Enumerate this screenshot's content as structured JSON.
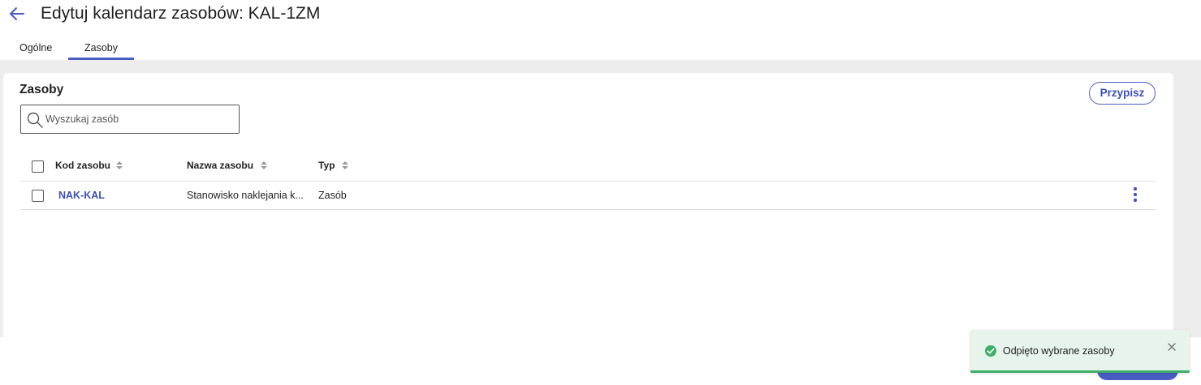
{
  "header": {
    "title": "Edytuj kalendarz zasobów: KAL-1ZM",
    "back_icon": "arrow-left-icon"
  },
  "tabs": [
    {
      "label": "Ogólne",
      "active": false
    },
    {
      "label": "Zasoby",
      "active": true
    }
  ],
  "panel": {
    "title": "Zasoby",
    "assign_label": "Przypisz",
    "search": {
      "placeholder": "Wyszukaj zasób",
      "value": ""
    }
  },
  "table": {
    "columns": [
      "Kod zasobu",
      "Nazwa zasobu",
      "Typ"
    ],
    "rows": [
      {
        "code": "NAK-KAL",
        "name": "Stanowisko naklejania k...",
        "type": "Zasób",
        "checked": false
      }
    ]
  },
  "toast": {
    "message": "Odpięto wybrane zasoby",
    "icon": "check-circle-icon",
    "close_icon": "close-icon"
  },
  "colors": {
    "accent": "#4a5cc4",
    "success": "#3fae6a",
    "toast_bg": "#e7f4ec",
    "page_bg": "#ededed"
  }
}
